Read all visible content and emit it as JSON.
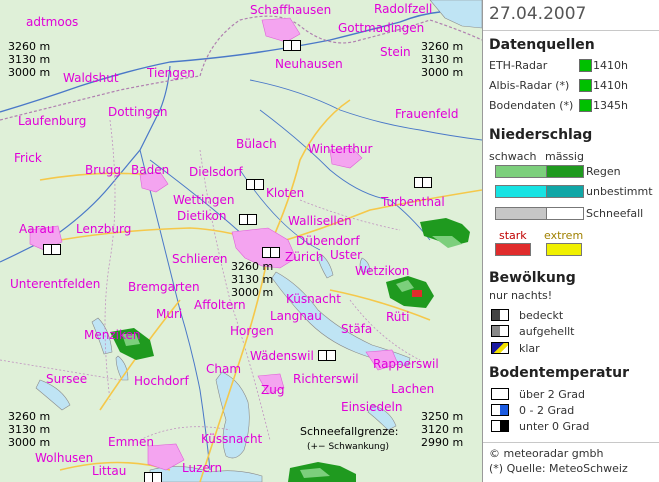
{
  "map": {
    "places": [
      {
        "id": "adtmoos",
        "text": "adtmoos"
      },
      {
        "id": "schaffhausen",
        "text": "Schaffhausen"
      },
      {
        "id": "radolfzell",
        "text": "Radolfzell"
      },
      {
        "id": "gottmadingen",
        "text": "Gottmadingen"
      },
      {
        "id": "stein",
        "text": "Stein"
      },
      {
        "id": "waldshut",
        "text": "Waldshut"
      },
      {
        "id": "tiengen",
        "text": "Tiengen"
      },
      {
        "id": "neuhausen",
        "text": "Neuhausen"
      },
      {
        "id": "laufenburg",
        "text": "Laufenburg"
      },
      {
        "id": "dottingen",
        "text": "Dottingen"
      },
      {
        "id": "frauenfeld",
        "text": "Frauenfeld"
      },
      {
        "id": "frick",
        "text": "Frick"
      },
      {
        "id": "buelach",
        "text": "Bülach"
      },
      {
        "id": "winterthur",
        "text": "Winterthur"
      },
      {
        "id": "brugg",
        "text": "Brugg"
      },
      {
        "id": "baden",
        "text": "Baden"
      },
      {
        "id": "dielsdorf",
        "text": "Dielsdorf"
      },
      {
        "id": "wettingen",
        "text": "Wettingen"
      },
      {
        "id": "kloten",
        "text": "Kloten"
      },
      {
        "id": "dietikon",
        "text": "Dietikon"
      },
      {
        "id": "wallisellen",
        "text": "Wallisellen"
      },
      {
        "id": "turbenthal",
        "text": "Turbenthal"
      },
      {
        "id": "aarau",
        "text": "Aarau"
      },
      {
        "id": "lenzburg",
        "text": "Lenzburg"
      },
      {
        "id": "duebendorf",
        "text": "Dübendorf"
      },
      {
        "id": "zuerich",
        "text": "Zürich"
      },
      {
        "id": "uster",
        "text": "Uster"
      },
      {
        "id": "schlieren",
        "text": "Schlieren"
      },
      {
        "id": "wetzikon",
        "text": "Wetzikon"
      },
      {
        "id": "unterentfelden",
        "text": "Unterentfelden"
      },
      {
        "id": "bremgarten",
        "text": "Bremgarten"
      },
      {
        "id": "affoltern",
        "text": "Affoltern"
      },
      {
        "id": "kuesnacht",
        "text": "Küsnacht"
      },
      {
        "id": "muri",
        "text": "Muri"
      },
      {
        "id": "langnau",
        "text": "Langnau"
      },
      {
        "id": "rueti",
        "text": "Rüti"
      },
      {
        "id": "menziken",
        "text": "Menziken"
      },
      {
        "id": "horgen",
        "text": "Horgen"
      },
      {
        "id": "staefa",
        "text": "Stäfa"
      },
      {
        "id": "waedenswil",
        "text": "Wädenswil"
      },
      {
        "id": "sursee",
        "text": "Sursee"
      },
      {
        "id": "hochdorf",
        "text": "Hochdorf"
      },
      {
        "id": "cham",
        "text": "Cham"
      },
      {
        "id": "richterswil",
        "text": "Richterswil"
      },
      {
        "id": "rapperswil",
        "text": "Rapperswil"
      },
      {
        "id": "zug",
        "text": "Zug"
      },
      {
        "id": "lachen",
        "text": "Lachen"
      },
      {
        "id": "einsiedeln",
        "text": "Einsiedeln"
      },
      {
        "id": "emmen",
        "text": "Emmen"
      },
      {
        "id": "kuessnacht",
        "text": "Küssnacht"
      },
      {
        "id": "wolhusen",
        "text": "Wolhusen"
      },
      {
        "id": "littau",
        "text": "Littau"
      },
      {
        "id": "luzern",
        "text": "Luzern"
      }
    ],
    "altitudes": {
      "top_left": [
        "3260 m",
        "3130 m",
        "3000 m"
      ],
      "top_right": [
        "3260 m",
        "3130 m",
        "3000 m"
      ],
      "center": [
        "3260 m",
        "3130 m",
        "3000 m"
      ],
      "bottom_left": [
        "3260 m",
        "3130 m",
        "3000 m"
      ],
      "bottom_right": [
        "3250 m",
        "3120 m",
        "2990 m"
      ]
    },
    "snowline_label": "Schneefallgrenze:",
    "snowline_sub": "(+− Schwankung)"
  },
  "panel": {
    "date": "27.04.2007",
    "sources_title": "Datenquellen",
    "sources": [
      {
        "label": "ETH-Radar",
        "time": "1410h"
      },
      {
        "label": "Albis-Radar (*)",
        "time": "1410h"
      },
      {
        "label": "Bodendaten (*)",
        "time": "1345h"
      }
    ],
    "precip_title": "Niederschlag",
    "precip_weak": "schwach",
    "precip_moderate": "mässig",
    "precip_types": [
      {
        "label": "Regen",
        "weak": "#7ccf7c",
        "moderate": "#1f9a1f"
      },
      {
        "label": "unbestimmt",
        "weak": "#17e3e3",
        "moderate": "#10a6a6"
      },
      {
        "label": "Schneefall",
        "weak": "#c6c6c6",
        "moderate": "#ffffff"
      }
    ],
    "precip_strong": "stark",
    "precip_extreme": "extrem",
    "color_strong": "#e02c2c",
    "color_extreme": "#f0f000",
    "cloud_title": "Bewölkung",
    "cloud_note": "nur nachts!",
    "cloud_items": [
      {
        "label": "bedeckt",
        "icon": "overcast-icon"
      },
      {
        "label": "aufgehellt",
        "icon": "partly-cloudy-icon"
      },
      {
        "label": "klar",
        "icon": "clear-icon"
      }
    ],
    "ground_title": "Bodentemperatur",
    "ground_items": [
      {
        "label": "über 2 Grad",
        "icon": "warm-ground-icon"
      },
      {
        "label": "0 - 2 Grad",
        "icon": "cool-ground-icon"
      },
      {
        "label": "unter 0 Grad",
        "icon": "frozen-ground-icon"
      }
    ],
    "copyright": "© meteoradar gmbh",
    "source_note": "(*) Quelle: MeteoSchweiz"
  }
}
